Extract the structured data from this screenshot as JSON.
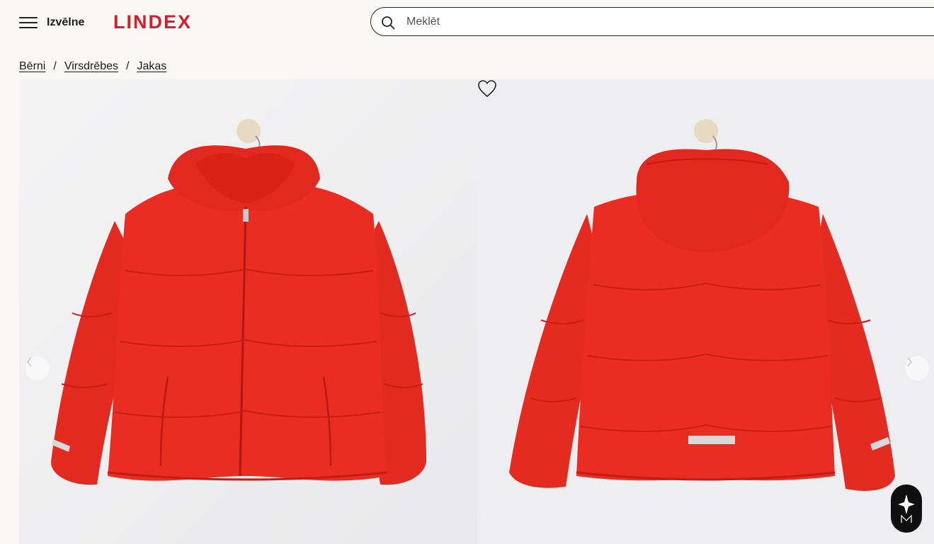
{
  "header": {
    "menu_label": "Izvēlne",
    "logo_text": "LINDEX",
    "brand_color": "#d11f2f"
  },
  "search": {
    "placeholder": "Meklēt",
    "value": ""
  },
  "breadcrumb": {
    "items": [
      "Bērni",
      "Virsdrēbes",
      "Jakas"
    ],
    "separator": "/"
  },
  "gallery": {
    "images": [
      {
        "name": "jacket-front-image",
        "description_color": "#ea2a22"
      },
      {
        "name": "jacket-back-image",
        "description_color": "#ea2a22"
      }
    ],
    "favorite_icon": "heart-outline-icon",
    "prev_icon": "chevron-left-icon",
    "next_icon": "chevron-right-icon"
  },
  "assistant_badge": {
    "icon": "sparkle-logo-icon"
  }
}
